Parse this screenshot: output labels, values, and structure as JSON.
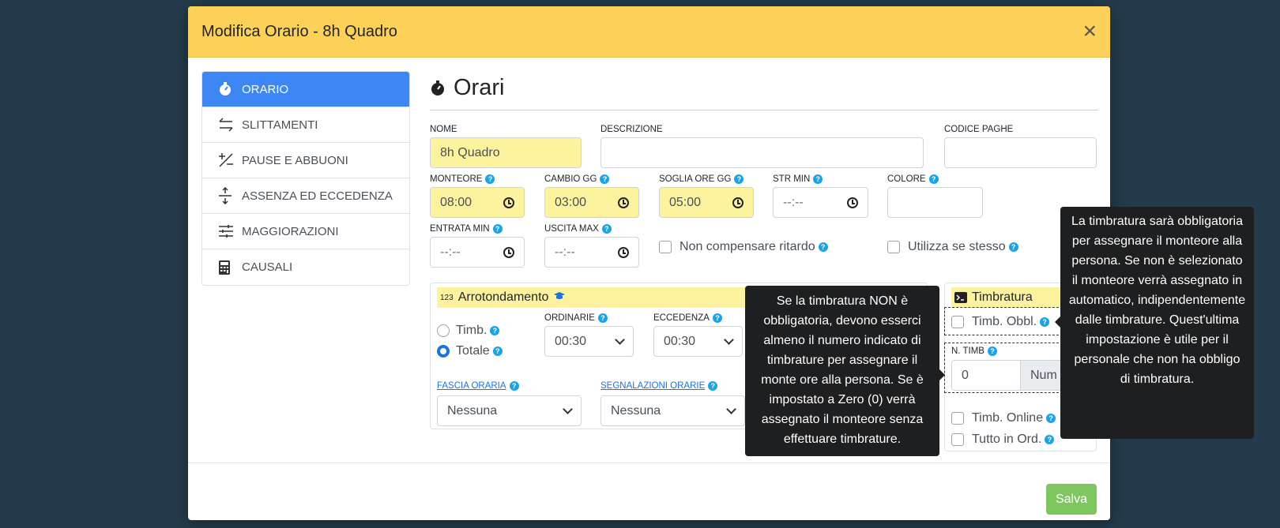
{
  "modal": {
    "title": "Modifica Orario - 8h Quadro",
    "close": "×"
  },
  "sidebar": {
    "items": [
      {
        "label": "ORARIO",
        "icon": "stopwatch-icon",
        "active": true
      },
      {
        "label": "SLITTAMENTI",
        "icon": "arrows-exchange-icon"
      },
      {
        "label": "PAUSE E ABBUONI",
        "icon": "plus-minus-icon"
      },
      {
        "label": "ASSENZA ED ECCEDENZA",
        "icon": "vertical-arrows-icon"
      },
      {
        "label": "MAGGIORAZIONI",
        "icon": "sliders-icon"
      },
      {
        "label": "CAUSALI",
        "icon": "calculator-icon"
      }
    ]
  },
  "main": {
    "title": "Orari",
    "nome": {
      "label": "NOME",
      "value": "8h Quadro"
    },
    "descrizione": {
      "label": "DESCRIZIONE",
      "value": ""
    },
    "codice_paghe": {
      "label": "CODICE PAGHE",
      "value": ""
    },
    "monteore": {
      "label": "MONTEORE",
      "value": "08:00"
    },
    "cambio_gg": {
      "label": "CAMBIO GG",
      "value": "03:00"
    },
    "soglia_ore_gg": {
      "label": "SOGLIA ORE GG",
      "value": "05:00"
    },
    "str_min": {
      "label": "STR MIN",
      "value": "--:--"
    },
    "colore": {
      "label": "COLORE",
      "value": ""
    },
    "entrata_min": {
      "label": "ENTRATA MIN",
      "value": "--:--"
    },
    "uscita_max": {
      "label": "USCITA MAX",
      "value": "--:--"
    },
    "non_compensare": "Non compensare ritardo",
    "utilizza_se_stesso": "Utilizza se stesso",
    "help_glyph": "?"
  },
  "arrotondamento": {
    "badge": "123",
    "title": "Arrotondamento",
    "radio_timb": "Timb.",
    "radio_totale": "Totale",
    "ordinarie": {
      "label": "ORDINARIE",
      "value": "00:30"
    },
    "eccedenza": {
      "label": "ECCEDENZA",
      "value": "00:30"
    },
    "fascia_oraria": {
      "label": "FASCIA ORARIA",
      "value": "Nessuna"
    },
    "segnalazioni_orarie": {
      "label": "SEGNALAZIONI ORARIE",
      "value": "Nessuna"
    }
  },
  "timbratura": {
    "title": "Timbratura",
    "timb_obbl": "Timb. Obbl.",
    "n_timb": {
      "label": "N. TIMB",
      "value": "0",
      "addon": "Num"
    },
    "timb_online": "Timb. Online",
    "tutto_in_ord": "Tutto in Ord."
  },
  "tooltips": {
    "n_timb": "Se la timbratura NON è obbligatoria, devono esserci almeno il numero indicato di timbrature per assegnare il monte ore alla persona. Se è impostato a Zero (0) verrà assegnato il monteore senza effettuare timbrature.",
    "timb_obbl": "La timbratura sarà obbligatoria per assegnare il monteore alla persona. Se non è selezionato il monteore verrà assegnato in automatico, indipendentemente dalle timbrature. Quest'ultima impostazione è utile per il personale che non ha obbligo di timbratura."
  },
  "footer": {
    "save_label": "Salva"
  },
  "colors": {
    "header": "#fcd158",
    "active": "#3d86f5",
    "highlight": "#fdf39f",
    "save": "#7ec660",
    "background": "#233b4a"
  }
}
